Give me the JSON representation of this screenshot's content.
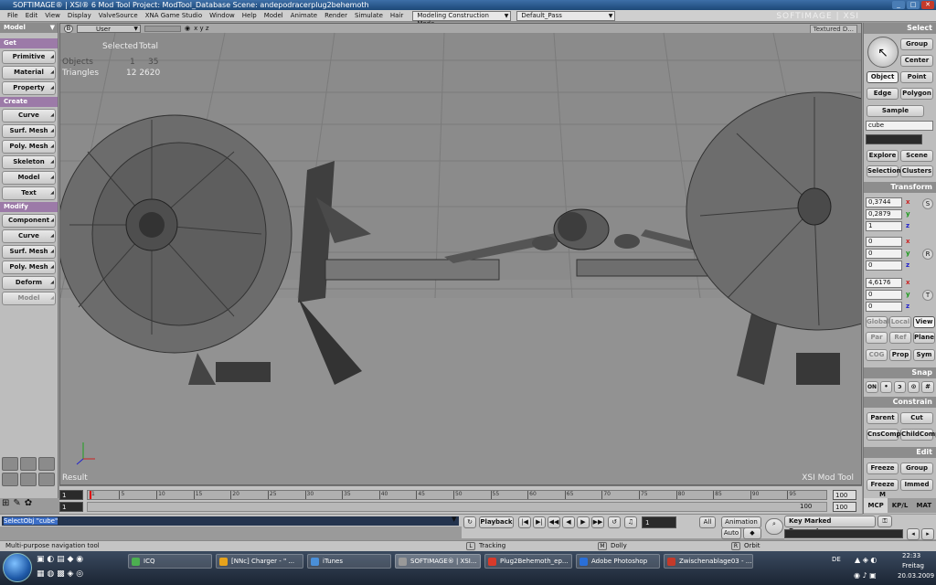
{
  "window": {
    "title": "SOFTIMAGE® | XSI® 6 Mod Tool Project: ModTool_Database    Scene: andepodracerplug2behemoth"
  },
  "menubar": {
    "items": [
      "File",
      "Edit",
      "View",
      "Display",
      "ValveSource",
      "XNA Game Studio",
      "Window",
      "Help",
      "Model",
      "Animate",
      "Render",
      "Simulate",
      "Hair"
    ],
    "mode": "Modeling Construction Mode",
    "pass": "Default_Pass"
  },
  "brand": "SOFTIMAGE | XSI",
  "left": {
    "mode": "Model",
    "sections": {
      "get": "Get",
      "create": "Create",
      "modify": "Modify"
    },
    "get": [
      "Primitive",
      "Material",
      "Property"
    ],
    "create": [
      "Curve",
      "Surf. Mesh",
      "Poly. Mesh",
      "Skeleton",
      "Model",
      "Text"
    ],
    "modify": [
      "Component",
      "Curve",
      "Surf. Mesh",
      "Poly. Mesh",
      "Deform",
      "Model"
    ]
  },
  "viewport": {
    "camera": "User",
    "axes": "x y z",
    "shading": "Textured D...",
    "stats": {
      "header1": "Selected",
      "header2": "Total",
      "row1_label": "Objects",
      "row1_sel": "1",
      "row1_tot": "35",
      "row2_label": "Triangles",
      "row2_tot": "12 2620"
    },
    "result": "Result",
    "brand": "XSI Mod Tool"
  },
  "timeline": {
    "start": "1",
    "start2": "1",
    "end": "100",
    "end2": "100",
    "current": "100",
    "ticks": [
      "1",
      "5",
      "10",
      "15",
      "20",
      "25",
      "30",
      "35",
      "40",
      "45",
      "50",
      "55",
      "60",
      "65",
      "70",
      "75",
      "80",
      "85",
      "90",
      "95"
    ]
  },
  "right": {
    "select_title": "Select",
    "group": "Group",
    "center": "Center",
    "object": "Object",
    "point": "Point",
    "edge": "Edge",
    "polygon": "Polygon",
    "sample": "Sample",
    "name_value": "cube",
    "explore": "Explore",
    "scene": "Scene",
    "selection": "Selection",
    "clusters": "Clusters",
    "transform_title": "Transform",
    "s_values": [
      "0,3744",
      "0,2879",
      "1"
    ],
    "r_values": [
      "0",
      "0",
      "0"
    ],
    "t_values": [
      "4,6176",
      "0",
      "0"
    ],
    "s_label": "S",
    "r_label": "R",
    "t_label": "T",
    "global": "Global",
    "local": "Local",
    "view": "View",
    "par": "Par",
    "ref": "Ref",
    "plane": "Plane",
    "cog": "COG",
    "prop": "Prop",
    "sym": "Sym",
    "snap_title": "Snap",
    "snap_on": "ON",
    "constrain_title": "Constrain",
    "parent": "Parent",
    "cut": "Cut",
    "cnscomp": "CnsComp",
    "childcomp": "ChildComp",
    "edit_title": "Edit",
    "freeze": "Freeze",
    "edit_group": "Group",
    "freeze_m": "Freeze M",
    "immed": "Immed",
    "tabs": [
      "MCP",
      "KP/L",
      "MAT"
    ]
  },
  "command": {
    "text": "SelectObj \"cube\""
  },
  "playback": {
    "label": "Playback",
    "frame": "1",
    "all": "All",
    "animation": "Animation",
    "auto": "Auto"
  },
  "kmp": {
    "label": "Key Marked Parameters"
  },
  "status": {
    "hint": "Multi-purpose navigation tool",
    "tracking": "Tracking",
    "dolly": "Dolly",
    "orbit": "Orbit",
    "l": "L",
    "m": "M",
    "r": "R"
  },
  "taskbar": {
    "items": [
      "ICQ",
      "[NNc] Charger - \" ...",
      "iTunes",
      "SOFTIMAGE® | XSI...",
      "Plug2Behemoth_ep...",
      "Adobe Photoshop",
      "Zwischenablage03 - ..."
    ],
    "lang": "DE",
    "time": "22:33",
    "day": "Freitag",
    "date": "20.03.2009"
  }
}
